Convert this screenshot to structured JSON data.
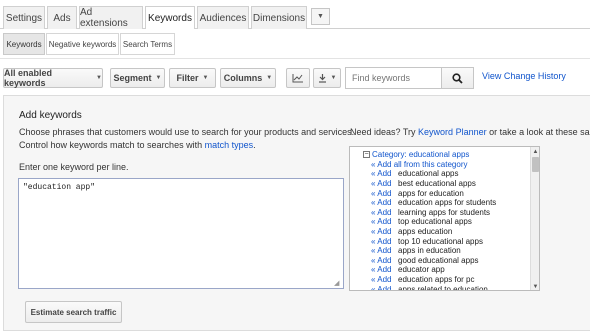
{
  "tabs": [
    {
      "label": "Settings",
      "active": false
    },
    {
      "label": "Ads",
      "active": false
    },
    {
      "label": "Ad extensions",
      "active": false
    },
    {
      "label": "Keywords",
      "active": true
    },
    {
      "label": "Audiences",
      "active": false
    },
    {
      "label": "Dimensions",
      "active": false
    }
  ],
  "tab_more_icon": "caret-down-icon",
  "subtabs": [
    {
      "label": "Keywords",
      "active": true
    },
    {
      "label": "Negative keywords",
      "active": false
    },
    {
      "label": "Search Terms",
      "active": false
    }
  ],
  "toolbar": {
    "filter_all": "All enabled keywords",
    "segment": "Segment",
    "filter": "Filter",
    "columns": "Columns",
    "chart_icon": "line-chart-icon",
    "download_icon": "download-icon",
    "search_placeholder": "Find keywords",
    "search_icon": "magnifier-icon",
    "view_history": "View Change History"
  },
  "add_keywords": {
    "title": "Add keywords",
    "desc_line1": "Choose phrases that customers would use to search for your products and services.",
    "desc_line2_prefix": "Control how keywords match to searches with ",
    "desc_line2_link": "match types",
    "desc_line2_suffix": ".",
    "enter_label": "Enter one keyword per line.",
    "keywords_value": "\"education app\"",
    "estimate_button": "Estimate search traffic"
  },
  "ideas": {
    "prefix": "Need ideas? Try ",
    "planner_link": "Keyword Planner",
    "suffix": " or take a look at these sample",
    "category_toggle": "−",
    "category": "Category: educational apps",
    "add_all": "« Add all from this category",
    "add_label": "« Add",
    "items": [
      "educational apps",
      "best educational apps",
      "apps for education",
      "education apps for students",
      "learning apps for students",
      "top educational apps",
      "apps education",
      "top 10 educational apps",
      "apps in education",
      "good educational apps",
      "educator app",
      "education apps for pc",
      "apps related to education"
    ]
  },
  "colors": {
    "link": "#1155cc",
    "panel_bg": "#f6f6f6",
    "tab_bg": "#f1f1f1"
  }
}
